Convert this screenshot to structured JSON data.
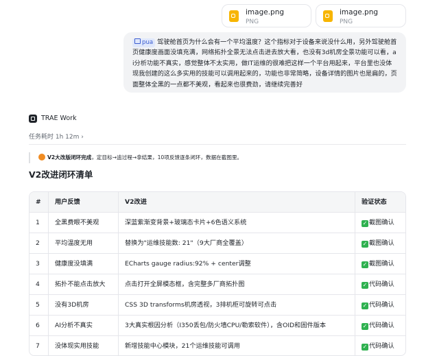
{
  "attachments": [
    {
      "name": "image.png",
      "type": "PNG"
    },
    {
      "name": "image.png",
      "type": "PNG"
    }
  ],
  "message": {
    "tag": "pua",
    "text": "驾驶舱首页为什么会有一个平均温度？这个指标对于设备来说没什么用，另外驾驶舱首页健康度画面没填充满，网络拓扑全景无法点击进去放大看，也没有3d机房全景功能可以看，ai分析功能不真实，感觉整体不太实用，做IT运维的很难把这样一个平台用起来，平台里也没体现我创建的这么多实用的技能可以调用起来的，功能也非常简略，设备详情的图片也是扁的，页面整体全黑的一点都不美观，看起来也很费劲，请继续完善好"
  },
  "agent": {
    "name": "TRAE Work",
    "runtime": "任务耗时 1h 12m",
    "runtime_chevron": "›"
  },
  "summary": {
    "bold": "V2大改版闭环完成",
    "rest": "，定目标→追过程→拿结果，10项反馈逐条闭环，数据在截图里。"
  },
  "heading": "V2改进闭环清单",
  "table": {
    "headers": [
      "#",
      "用户反馈",
      "V2改进",
      "验证状态"
    ],
    "check_glyph": "✓",
    "rows": [
      {
        "num": "1",
        "feedback": "全黑费眼不美观",
        "improvement": "深蓝紫渐变背景+玻璃态卡片+6色语义系统",
        "status": "截图确认"
      },
      {
        "num": "2",
        "feedback": "平均温度无用",
        "improvement": "替换为\"运维技能数: 21\"（9大厂商全覆盖）",
        "status": "截图确认"
      },
      {
        "num": "3",
        "feedback": "健康度没填满",
        "improvement": "ECharts gauge radius:92% + center调整",
        "status": "截图确认"
      },
      {
        "num": "4",
        "feedback": "拓扑不能点击放大",
        "improvement": "点击打开全屏模态框，含完整多厂商拓扑图",
        "status": "代码确认"
      },
      {
        "num": "5",
        "feedback": "没有3D机房",
        "improvement": "CSS 3D transforms机房透视，3排机柜可旋转可点击",
        "status": "代码确认"
      },
      {
        "num": "6",
        "feedback": "AI分析不真实",
        "improvement": "3大真实根因分析（I350丢包/防火墙CPU/勒索软件），含OID和固件版本",
        "status": "代码确认"
      },
      {
        "num": "7",
        "feedback": "没体现实用技能",
        "improvement": "新增技能中心模块，21个运维技能可调用",
        "status": "代码确认"
      }
    ]
  },
  "colors": {
    "check": "#2fb150",
    "accent": "#3a5cd0",
    "orange": "#f08c23"
  }
}
